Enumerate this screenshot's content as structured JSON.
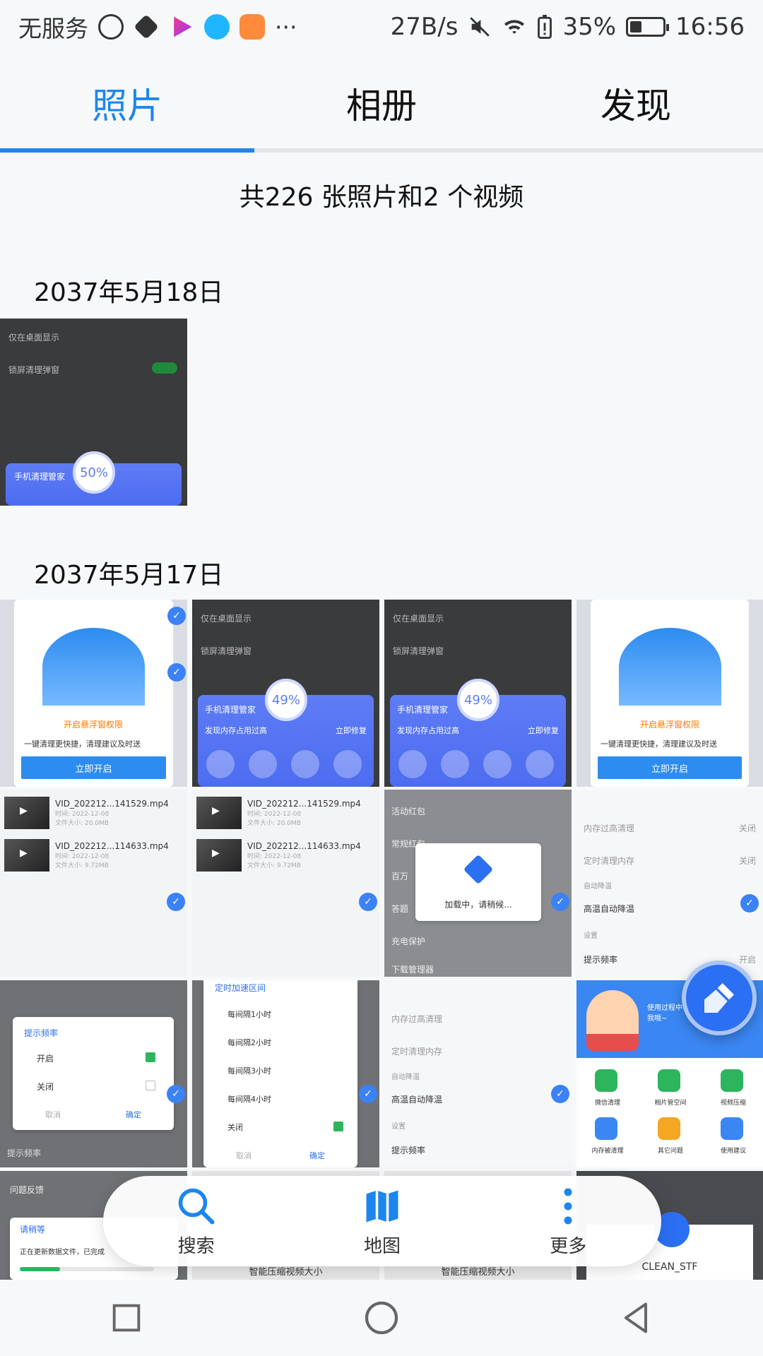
{
  "status_bar": {
    "carrier": "无服务",
    "net_speed": "27B/s",
    "battery_percent": "35%",
    "time": "16:56"
  },
  "tabs": [
    {
      "label": "照片",
      "active": true
    },
    {
      "label": "相册",
      "active": false
    },
    {
      "label": "发现",
      "active": false
    }
  ],
  "summary": "共226 张照片和2 个视频",
  "groups": [
    {
      "date": "2037年5月18日"
    },
    {
      "date": "2037年5月17日"
    }
  ],
  "thumbs_text": {
    "t1": {
      "row1": "仅在桌面显示",
      "row2": "锁屏清理弹窗",
      "app": "手机清理管家",
      "percent": "50%"
    },
    "t2a": {
      "title": "开启悬浮窗权限",
      "desc": "一键清理更快捷，清理建议及时送",
      "cta": "立即开启"
    },
    "t2b": {
      "row1": "仅在桌面显示",
      "row2": "锁屏清理弹窗",
      "app": "手机清理管家",
      "percent": "49%",
      "notice": "发现内存占用过高",
      "action": "立即修复"
    },
    "videos": [
      {
        "name": "VID_202212...141529.mp4",
        "date": "时间: 2022-12-08",
        "size": "文件大小: 20.0MB"
      },
      {
        "name": "VID_202212...114633.mp4",
        "date": "时间: 2022-12-08",
        "size": "文件大小: 9.72MB"
      }
    ],
    "loading": {
      "text": "加载中，请稍候..."
    },
    "menu_items": [
      "活动红包",
      "常规红包",
      "百万",
      "答题",
      "充电保护",
      "下载管理器"
    ],
    "settings_items": [
      "内存过高清理",
      "定时清理内存",
      "自动降温",
      "高温自动降温",
      "设置",
      "提示频率"
    ],
    "settings_values": [
      "关闭",
      "关闭",
      "开启"
    ],
    "dialog1": {
      "title": "提示频率",
      "opt1": "开启",
      "opt2": "关闭",
      "cancel": "取消",
      "ok": "确定"
    },
    "dialog2": {
      "title": "定时加速区间",
      "opts": [
        "每间隔1小时",
        "每间隔2小时",
        "每间隔3小时",
        "每间隔4小时",
        "关闭"
      ],
      "cancel": "取消",
      "ok": "确定"
    },
    "clean_app": {
      "bubble": "使用过程中有任何疑问可以反馈给我哦~",
      "apps": [
        "微信清理",
        "相片管空间",
        "视频压缩",
        "内存被清理",
        "其它问题",
        "使用建议"
      ]
    },
    "bottom_row": {
      "feedback": "问题反馈",
      "wait": "请稍等",
      "updating": "正在更新数据文件，已完成",
      "compress": "智能压缩视频大小",
      "clean_stf": "CLEAN_STF"
    }
  },
  "bottom_nav": [
    {
      "label": "搜索",
      "icon": "search-icon"
    },
    {
      "label": "地图",
      "icon": "map-icon"
    },
    {
      "label": "更多",
      "icon": "more-vertical-icon"
    }
  ],
  "colors": {
    "accent": "#1c86ee",
    "brand_blue": "#2b6ff2"
  }
}
